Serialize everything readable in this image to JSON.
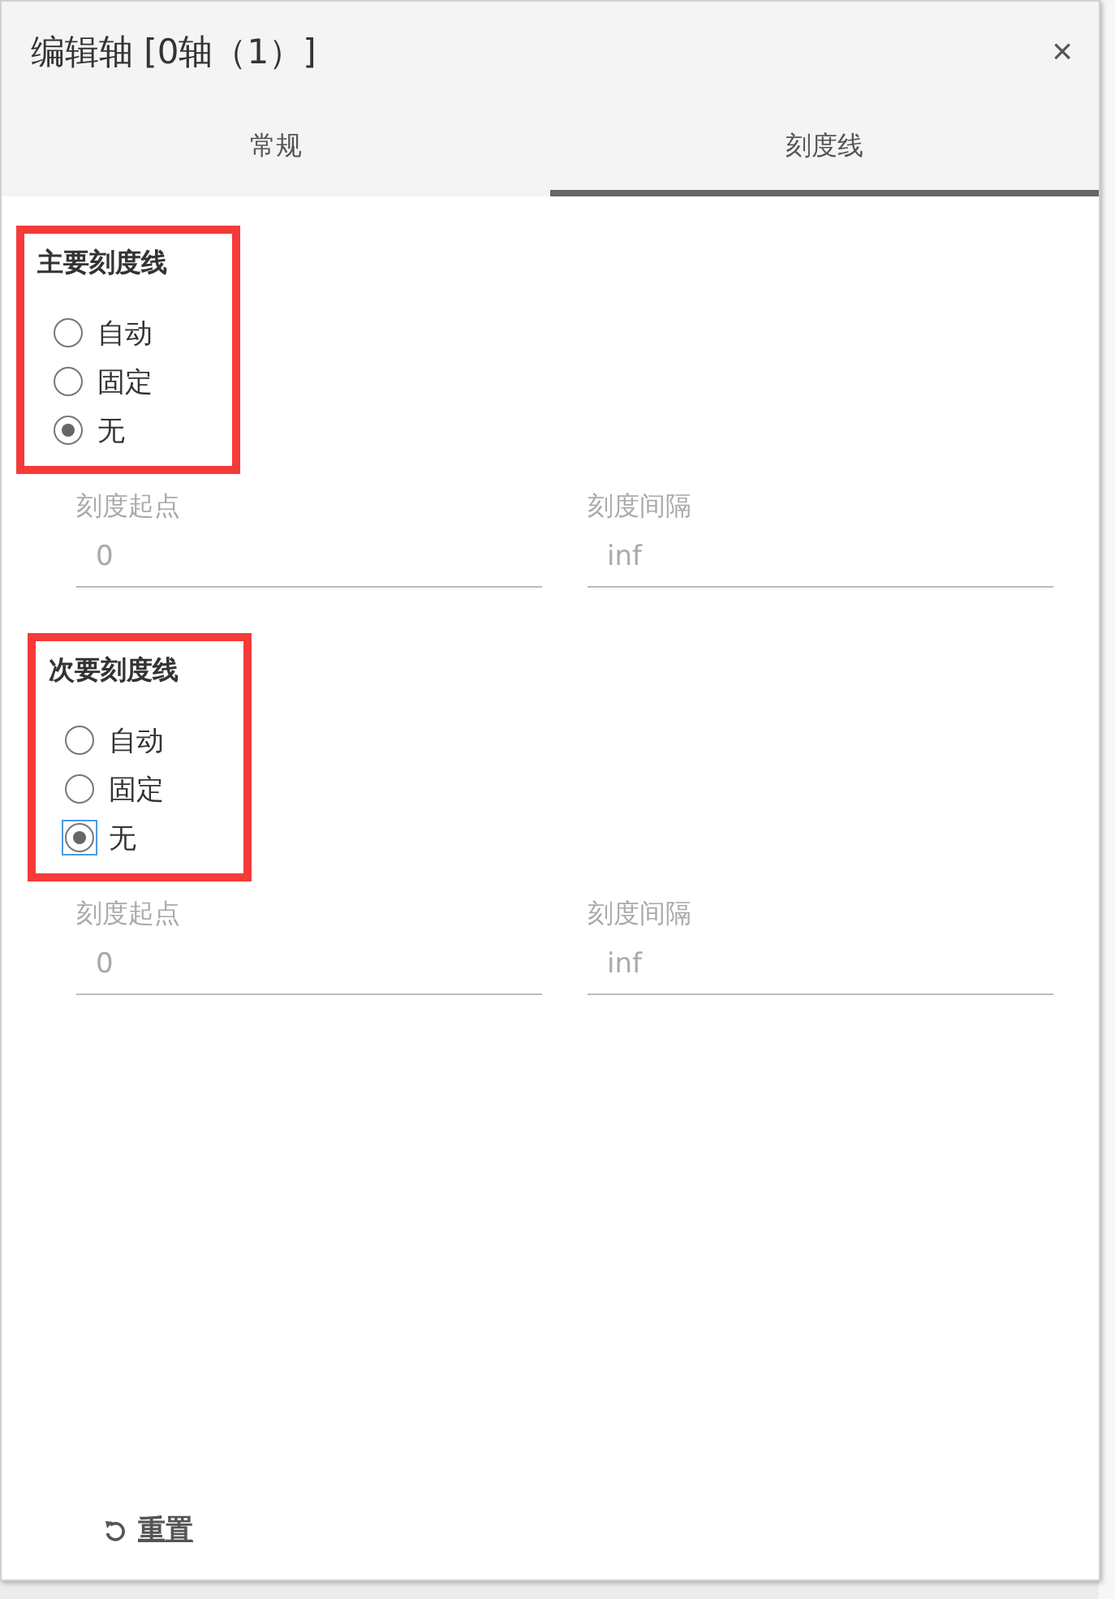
{
  "window": {
    "title": "编辑轴 [0轴（1）]",
    "close": "×"
  },
  "tabs": [
    {
      "label": "常规",
      "selected": false
    },
    {
      "label": "刻度线",
      "selected": true
    }
  ],
  "sections": [
    {
      "title": "主要刻度线",
      "options": [
        {
          "label": "自动",
          "selected": false,
          "focused": false
        },
        {
          "label": "固定",
          "selected": false,
          "focused": false
        },
        {
          "label": "无",
          "selected": true,
          "focused": false
        }
      ],
      "fields": [
        {
          "label": "刻度起点",
          "value": "0",
          "disabled": true
        },
        {
          "label": "刻度间隔",
          "value": "inf",
          "disabled": true
        }
      ]
    },
    {
      "title": "次要刻度线",
      "options": [
        {
          "label": "自动",
          "selected": false,
          "focused": false
        },
        {
          "label": "固定",
          "selected": false,
          "focused": false
        },
        {
          "label": "无",
          "selected": true,
          "focused": true
        }
      ],
      "fields": [
        {
          "label": "刻度起点",
          "value": "0",
          "disabled": true
        },
        {
          "label": "刻度间隔",
          "value": "inf",
          "disabled": true
        }
      ]
    }
  ],
  "reset_button": {
    "label": "重置"
  }
}
